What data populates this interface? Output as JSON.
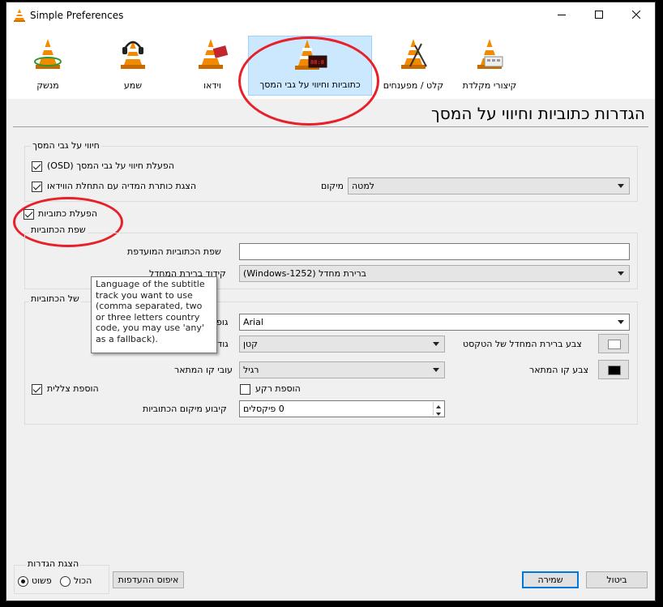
{
  "window": {
    "title": "Simple Preferences"
  },
  "toolbar": [
    {
      "label": "קיצורי מקלדת",
      "icon": "keyboard-shortcuts-icon"
    },
    {
      "label": "קלט / מפענחים",
      "icon": "input-codecs-icon"
    },
    {
      "label": "כתוביות וחיווי על גבי המסך",
      "icon": "subtitles-osd-icon",
      "selected": true
    },
    {
      "label": "וידאו",
      "icon": "video-icon"
    },
    {
      "label": "שמע",
      "icon": "audio-icon"
    },
    {
      "label": "מנשק",
      "icon": "interface-icon"
    }
  ],
  "page_heading": "הגדרות כתוביות וחיווי על המסך",
  "osd": {
    "group_label": "חיווי על גבי המסך",
    "enable_osd": {
      "label": "הפעלת חיווי על גבי המסך (OSD)",
      "checked": true
    },
    "show_title": {
      "label": "הצגת כותרת המדיה עם התחלת הווידאו",
      "checked": true
    },
    "position_label": "מיקום",
    "position_value": "למטה"
  },
  "subtitles": {
    "enable": {
      "label": "הפעלת כתוביות",
      "checked": true
    },
    "language_group_label": "שפת הכתוביות",
    "preferred_language_label": "שפת הכתוביות המועדפת",
    "preferred_language_value": "",
    "encoding_label_partial": "קידוד ברירת המחדל",
    "encoding_value": "ברירת מחדל (Windows-1252)"
  },
  "tooltip": {
    "text": "Language of the subtitle track you want to use (comma separated, two or three letters country code, you may use 'any' as a fallback)."
  },
  "effects": {
    "group_label_partial": "של הכתוביות",
    "font_label": "גופן",
    "font_value": "Arial",
    "size_label": "גודל",
    "size_value": "קטן",
    "outline_thickness_label": "עובי קו המתאר",
    "outline_thickness_value": "רגיל",
    "text_color_label": "צבע ברירת המחדל של הטקסט",
    "text_color": "#ffffff",
    "outline_color_label": "צבע קו המתאר",
    "outline_color": "#000000",
    "add_shadow": {
      "label": "הוספת צללית",
      "checked": true
    },
    "add_background": {
      "label": "הוספת רקע",
      "checked": false
    },
    "position_label": "קיבוע מיקום הכתוביות",
    "position_value": "0 פיקסלים"
  },
  "show_settings": {
    "group_label": "הצגת הגדרות",
    "simple_label": "פשוט",
    "all_label": "הכול",
    "selected": "simple"
  },
  "buttons": {
    "reset": "איפוס ההעדפות",
    "save": "שמירה",
    "cancel": "ביטול"
  },
  "colors": {
    "selected_tab": "#cce8ff",
    "annotation": "#e8202a",
    "focus": "#0078d7"
  }
}
